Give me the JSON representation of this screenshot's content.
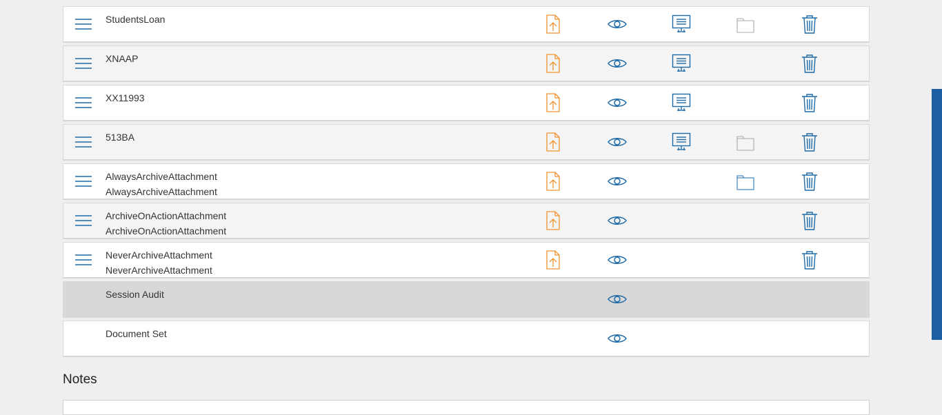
{
  "colors": {
    "accent_blue": "#1d6aa8",
    "upload_orange": "#f0922e",
    "folder_gray": "#a9a9a9",
    "folder_blue": "#4a8bc2",
    "scrollbar": "#1d5fa3"
  },
  "icons": {
    "handle": "hamburger-drag-handle",
    "upload": "file-upload-icon",
    "view": "eye-icon",
    "present": "presentation-icon",
    "folder": "folder-icon",
    "delete": "trash-icon"
  },
  "rows": [
    {
      "lines": [
        "StudentsLoan"
      ],
      "handle": true,
      "upload": true,
      "view": true,
      "present": true,
      "folder": "gray",
      "delete": true,
      "style": "white"
    },
    {
      "lines": [
        "XNAAP"
      ],
      "handle": true,
      "upload": true,
      "view": true,
      "present": true,
      "folder": null,
      "delete": true,
      "style": "alt"
    },
    {
      "lines": [
        "XX11993"
      ],
      "handle": true,
      "upload": true,
      "view": true,
      "present": true,
      "folder": null,
      "delete": true,
      "style": "white"
    },
    {
      "lines": [
        "513BA"
      ],
      "handle": true,
      "upload": true,
      "view": true,
      "present": true,
      "folder": "gray",
      "delete": true,
      "style": "alt"
    },
    {
      "lines": [
        "AlwaysArchiveAttachment",
        "AlwaysArchiveAttachment"
      ],
      "handle": true,
      "upload": true,
      "view": true,
      "present": false,
      "folder": "blue",
      "delete": true,
      "style": "white"
    },
    {
      "lines": [
        "ArchiveOnActionAttachment",
        "ArchiveOnActionAttachment"
      ],
      "handle": true,
      "upload": true,
      "view": true,
      "present": false,
      "folder": null,
      "delete": true,
      "style": "alt"
    },
    {
      "lines": [
        "NeverArchiveAttachment",
        "NeverArchiveAttachment"
      ],
      "handle": true,
      "upload": true,
      "view": true,
      "present": false,
      "folder": null,
      "delete": true,
      "style": "white"
    },
    {
      "lines": [
        "Session Audit"
      ],
      "handle": false,
      "upload": false,
      "view": true,
      "present": false,
      "folder": null,
      "delete": false,
      "style": "dark"
    },
    {
      "lines": [
        "Document Set"
      ],
      "handle": false,
      "upload": false,
      "view": true,
      "present": false,
      "folder": null,
      "delete": false,
      "style": "white"
    }
  ],
  "notes": {
    "heading": "Notes"
  }
}
